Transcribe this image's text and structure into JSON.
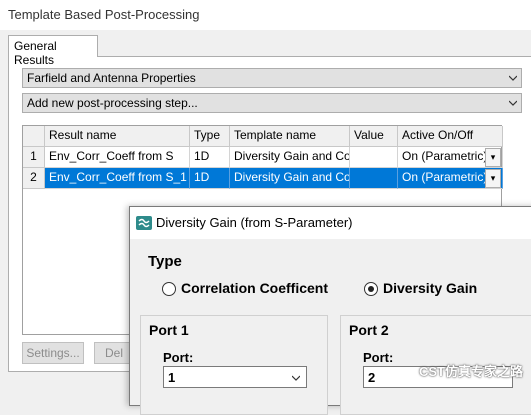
{
  "window": {
    "title": "Template Based Post-Processing"
  },
  "tabs": [
    {
      "label": "General Results"
    }
  ],
  "combo1": {
    "value": "Farfield and Antenna Properties"
  },
  "combo2": {
    "value": "Add new post-processing step..."
  },
  "table": {
    "headers": [
      "Result name",
      "Type",
      "Template name",
      "Value",
      "Active On/Off"
    ],
    "rows": [
      {
        "num": "1",
        "name": "Env_Corr_Coeff from S",
        "type": "1D",
        "template": "Diversity Gain and Corre",
        "value": "",
        "active": "On (Parametric)"
      },
      {
        "num": "2",
        "name": "Env_Corr_Coeff from S_1",
        "type": "1D",
        "template": "Diversity Gain and Corre",
        "value": "",
        "active": "On (Parametric)"
      }
    ]
  },
  "buttons": {
    "settings": "Settings...",
    "delete": "Del"
  },
  "dialog": {
    "title": "Diversity Gain (from S-Parameter)",
    "type_label": "Type",
    "radio_correlation": "Correlation Coefficent",
    "radio_diversity": "Diversity Gain",
    "radio_selected": "diversity",
    "port1": {
      "group": "Port 1",
      "label": "Port:",
      "value": "1"
    },
    "port2": {
      "group": "Port 2",
      "label": "Port:",
      "value": "2"
    }
  },
  "watermark": "CST仿真专家之路",
  "colors": {
    "selection": "#0078d7",
    "dialog_icon": "#2e8b8b"
  }
}
